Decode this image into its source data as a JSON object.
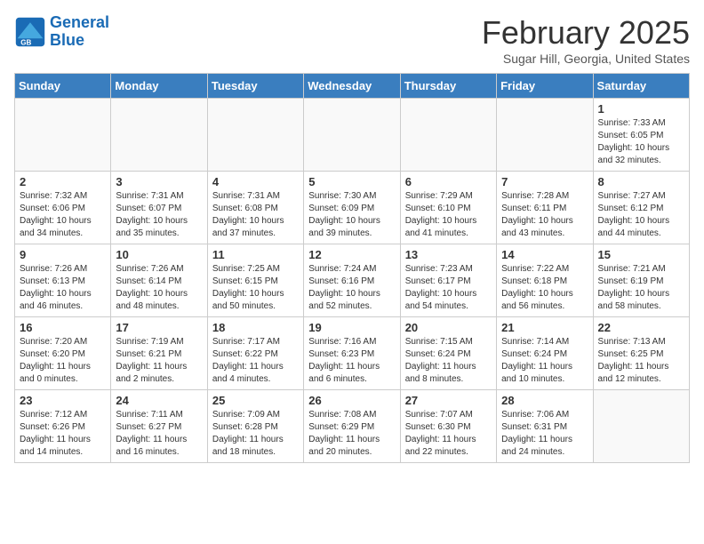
{
  "header": {
    "logo_line1": "General",
    "logo_line2": "Blue",
    "month": "February 2025",
    "location": "Sugar Hill, Georgia, United States"
  },
  "weekdays": [
    "Sunday",
    "Monday",
    "Tuesday",
    "Wednesday",
    "Thursday",
    "Friday",
    "Saturday"
  ],
  "weeks": [
    [
      {
        "day": "",
        "info": ""
      },
      {
        "day": "",
        "info": ""
      },
      {
        "day": "",
        "info": ""
      },
      {
        "day": "",
        "info": ""
      },
      {
        "day": "",
        "info": ""
      },
      {
        "day": "",
        "info": ""
      },
      {
        "day": "1",
        "info": "Sunrise: 7:33 AM\nSunset: 6:05 PM\nDaylight: 10 hours and 32 minutes."
      }
    ],
    [
      {
        "day": "2",
        "info": "Sunrise: 7:32 AM\nSunset: 6:06 PM\nDaylight: 10 hours and 34 minutes."
      },
      {
        "day": "3",
        "info": "Sunrise: 7:31 AM\nSunset: 6:07 PM\nDaylight: 10 hours and 35 minutes."
      },
      {
        "day": "4",
        "info": "Sunrise: 7:31 AM\nSunset: 6:08 PM\nDaylight: 10 hours and 37 minutes."
      },
      {
        "day": "5",
        "info": "Sunrise: 7:30 AM\nSunset: 6:09 PM\nDaylight: 10 hours and 39 minutes."
      },
      {
        "day": "6",
        "info": "Sunrise: 7:29 AM\nSunset: 6:10 PM\nDaylight: 10 hours and 41 minutes."
      },
      {
        "day": "7",
        "info": "Sunrise: 7:28 AM\nSunset: 6:11 PM\nDaylight: 10 hours and 43 minutes."
      },
      {
        "day": "8",
        "info": "Sunrise: 7:27 AM\nSunset: 6:12 PM\nDaylight: 10 hours and 44 minutes."
      }
    ],
    [
      {
        "day": "9",
        "info": "Sunrise: 7:26 AM\nSunset: 6:13 PM\nDaylight: 10 hours and 46 minutes."
      },
      {
        "day": "10",
        "info": "Sunrise: 7:26 AM\nSunset: 6:14 PM\nDaylight: 10 hours and 48 minutes."
      },
      {
        "day": "11",
        "info": "Sunrise: 7:25 AM\nSunset: 6:15 PM\nDaylight: 10 hours and 50 minutes."
      },
      {
        "day": "12",
        "info": "Sunrise: 7:24 AM\nSunset: 6:16 PM\nDaylight: 10 hours and 52 minutes."
      },
      {
        "day": "13",
        "info": "Sunrise: 7:23 AM\nSunset: 6:17 PM\nDaylight: 10 hours and 54 minutes."
      },
      {
        "day": "14",
        "info": "Sunrise: 7:22 AM\nSunset: 6:18 PM\nDaylight: 10 hours and 56 minutes."
      },
      {
        "day": "15",
        "info": "Sunrise: 7:21 AM\nSunset: 6:19 PM\nDaylight: 10 hours and 58 minutes."
      }
    ],
    [
      {
        "day": "16",
        "info": "Sunrise: 7:20 AM\nSunset: 6:20 PM\nDaylight: 11 hours and 0 minutes."
      },
      {
        "day": "17",
        "info": "Sunrise: 7:19 AM\nSunset: 6:21 PM\nDaylight: 11 hours and 2 minutes."
      },
      {
        "day": "18",
        "info": "Sunrise: 7:17 AM\nSunset: 6:22 PM\nDaylight: 11 hours and 4 minutes."
      },
      {
        "day": "19",
        "info": "Sunrise: 7:16 AM\nSunset: 6:23 PM\nDaylight: 11 hours and 6 minutes."
      },
      {
        "day": "20",
        "info": "Sunrise: 7:15 AM\nSunset: 6:24 PM\nDaylight: 11 hours and 8 minutes."
      },
      {
        "day": "21",
        "info": "Sunrise: 7:14 AM\nSunset: 6:24 PM\nDaylight: 11 hours and 10 minutes."
      },
      {
        "day": "22",
        "info": "Sunrise: 7:13 AM\nSunset: 6:25 PM\nDaylight: 11 hours and 12 minutes."
      }
    ],
    [
      {
        "day": "23",
        "info": "Sunrise: 7:12 AM\nSunset: 6:26 PM\nDaylight: 11 hours and 14 minutes."
      },
      {
        "day": "24",
        "info": "Sunrise: 7:11 AM\nSunset: 6:27 PM\nDaylight: 11 hours and 16 minutes."
      },
      {
        "day": "25",
        "info": "Sunrise: 7:09 AM\nSunset: 6:28 PM\nDaylight: 11 hours and 18 minutes."
      },
      {
        "day": "26",
        "info": "Sunrise: 7:08 AM\nSunset: 6:29 PM\nDaylight: 11 hours and 20 minutes."
      },
      {
        "day": "27",
        "info": "Sunrise: 7:07 AM\nSunset: 6:30 PM\nDaylight: 11 hours and 22 minutes."
      },
      {
        "day": "28",
        "info": "Sunrise: 7:06 AM\nSunset: 6:31 PM\nDaylight: 11 hours and 24 minutes."
      },
      {
        "day": "",
        "info": ""
      }
    ]
  ]
}
